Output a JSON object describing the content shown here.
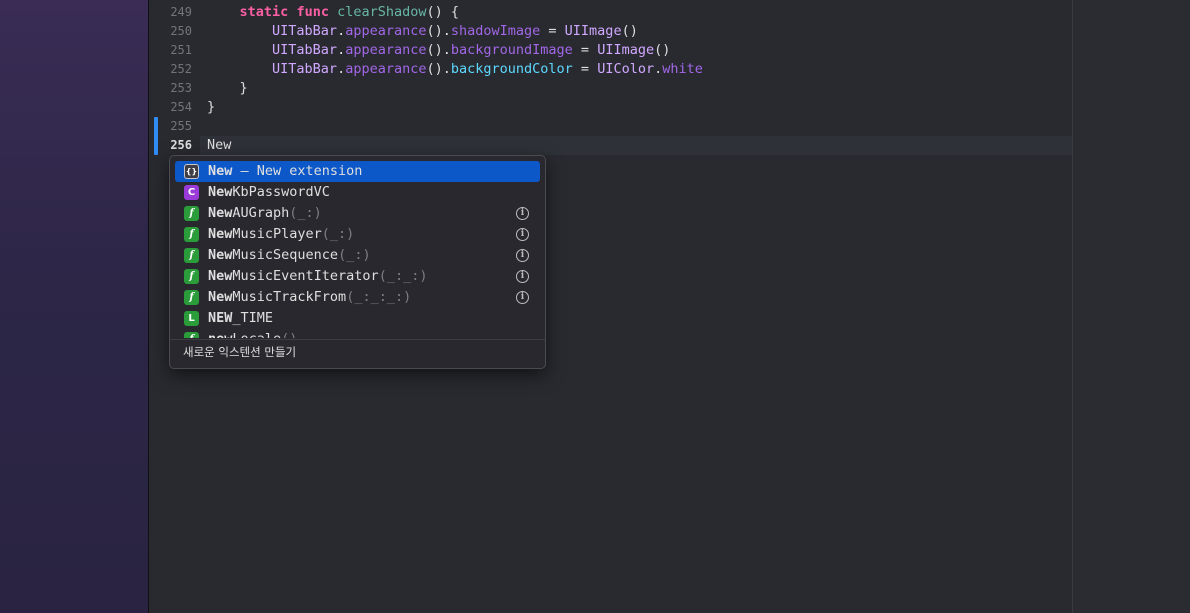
{
  "editor": {
    "lines": [
      {
        "num": "249",
        "tokens": [
          {
            "t": "    "
          },
          {
            "t": "static",
            "c": "kw"
          },
          {
            "t": " "
          },
          {
            "t": "func",
            "c": "kw"
          },
          {
            "t": " "
          },
          {
            "t": "clearShadow",
            "c": "fn"
          },
          {
            "t": "() {"
          }
        ]
      },
      {
        "num": "250",
        "tokens": [
          {
            "t": "        "
          },
          {
            "t": "UITabBar",
            "c": "ty"
          },
          {
            "t": "."
          },
          {
            "t": "appearance",
            "c": "prop"
          },
          {
            "t": "()."
          },
          {
            "t": "shadowImage",
            "c": "prop"
          },
          {
            "t": " = "
          },
          {
            "t": "UIImage",
            "c": "ty"
          },
          {
            "t": "()"
          }
        ]
      },
      {
        "num": "251",
        "tokens": [
          {
            "t": "        "
          },
          {
            "t": "UITabBar",
            "c": "ty"
          },
          {
            "t": "."
          },
          {
            "t": "appearance",
            "c": "prop"
          },
          {
            "t": "()."
          },
          {
            "t": "backgroundImage",
            "c": "prop"
          },
          {
            "t": " = "
          },
          {
            "t": "UIImage",
            "c": "ty"
          },
          {
            "t": "()"
          }
        ]
      },
      {
        "num": "252",
        "tokens": [
          {
            "t": "        "
          },
          {
            "t": "UITabBar",
            "c": "ty"
          },
          {
            "t": "."
          },
          {
            "t": "appearance",
            "c": "prop"
          },
          {
            "t": "()."
          },
          {
            "t": "backgroundColor",
            "c": "prop2"
          },
          {
            "t": " = "
          },
          {
            "t": "UIColor",
            "c": "ty"
          },
          {
            "t": "."
          },
          {
            "t": "white",
            "c": "prop"
          }
        ]
      },
      {
        "num": "253",
        "tokens": [
          {
            "t": "    }"
          }
        ]
      },
      {
        "num": "254",
        "tokens": [
          {
            "t": "}"
          }
        ]
      },
      {
        "num": "255",
        "tokens": []
      },
      {
        "num": "256",
        "tokens": [
          {
            "t": "New"
          }
        ],
        "active": true
      }
    ]
  },
  "completion": {
    "items": [
      {
        "kind": "ext",
        "badge": "{}",
        "bold": "New",
        "rest": " – New extension",
        "params": "",
        "info": false,
        "selected": true
      },
      {
        "kind": "cls",
        "badge": "C",
        "bold": "New",
        "rest": "KbPasswordVC",
        "params": "",
        "info": false
      },
      {
        "kind": "func",
        "badge": "f",
        "bold": "New",
        "rest": "AUGraph",
        "params": "(_:)",
        "info": true
      },
      {
        "kind": "func",
        "badge": "f",
        "bold": "New",
        "rest": "MusicPlayer",
        "params": "(_:)",
        "info": true
      },
      {
        "kind": "func",
        "badge": "f",
        "bold": "New",
        "rest": "MusicSequence",
        "params": "(_:)",
        "info": true
      },
      {
        "kind": "func",
        "badge": "f",
        "bold": "New",
        "rest": "MusicEventIterator",
        "params": "(_:_:)",
        "info": true
      },
      {
        "kind": "func",
        "badge": "f",
        "bold": "New",
        "rest": "MusicTrackFrom",
        "params": "(_:_:_:)",
        "info": true
      },
      {
        "kind": "lit",
        "badge": "L",
        "bold": "NEW",
        "rest": "_TIME",
        "params": "",
        "info": false
      },
      {
        "kind": "func",
        "badge": "f",
        "bold": "new",
        "rest": "Locale",
        "params": "()",
        "info": false
      }
    ],
    "footer": "새로운 익스텐션 만들기"
  }
}
